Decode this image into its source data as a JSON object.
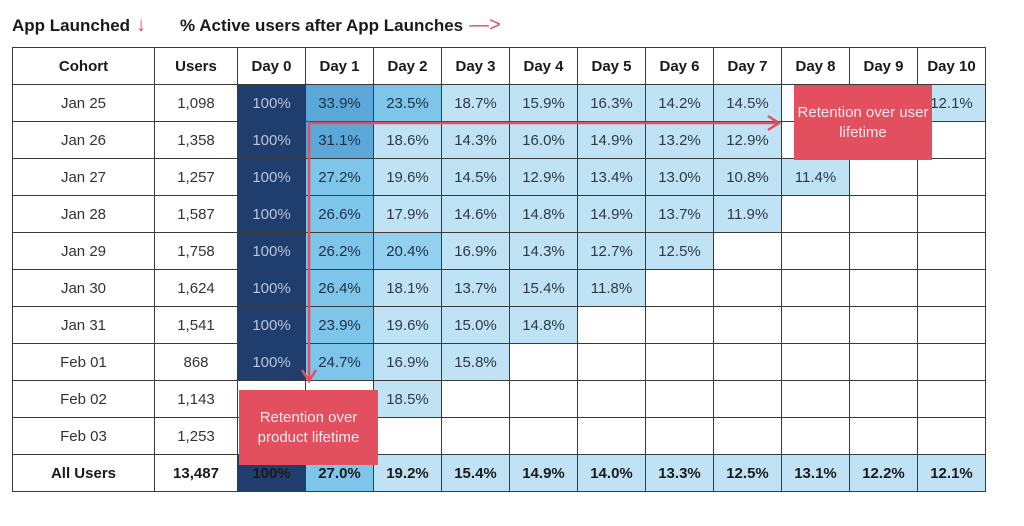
{
  "header": {
    "left_label": "App Launched",
    "left_arrow": "↓",
    "right_label": "% Active users after App Launches",
    "right_arrow": "—>"
  },
  "callouts": {
    "user_lifetime": "Retention over user lifetime",
    "product_lifetime": "Retention over product lifetime"
  },
  "colors": {
    "day0": "#1f3e6e",
    "high": "#5ba8d8",
    "mid_high": "#7ec5ea",
    "mid": "#93d0ef",
    "low": "#bfe3f4",
    "accent": "#e2505f"
  },
  "chart_data": {
    "type": "table",
    "title": "% Active users after App Launches",
    "columns": [
      "Cohort",
      "Users",
      "Day 0",
      "Day 1",
      "Day 2",
      "Day 3",
      "Day 4",
      "Day 5",
      "Day 6",
      "Day 7",
      "Day 8",
      "Day 9",
      "Day 10"
    ],
    "rows": [
      {
        "cohort": "Jan 25",
        "users": "1,098",
        "values": [
          "100%",
          "33.9%",
          "23.5%",
          "18.7%",
          "15.9%",
          "16.3%",
          "14.2%",
          "14.5%",
          "",
          "",
          "12.1%"
        ]
      },
      {
        "cohort": "Jan 26",
        "users": "1,358",
        "values": [
          "100%",
          "31.1%",
          "18.6%",
          "14.3%",
          "16.0%",
          "14.9%",
          "13.2%",
          "12.9%",
          "",
          "",
          ""
        ]
      },
      {
        "cohort": "Jan 27",
        "users": "1,257",
        "values": [
          "100%",
          "27.2%",
          "19.6%",
          "14.5%",
          "12.9%",
          "13.4%",
          "13.0%",
          "10.8%",
          "11.4%",
          "",
          ""
        ]
      },
      {
        "cohort": "Jan 28",
        "users": "1,587",
        "values": [
          "100%",
          "26.6%",
          "17.9%",
          "14.6%",
          "14.8%",
          "14.9%",
          "13.7%",
          "11.9%",
          "",
          "",
          ""
        ]
      },
      {
        "cohort": "Jan 29",
        "users": "1,758",
        "values": [
          "100%",
          "26.2%",
          "20.4%",
          "16.9%",
          "14.3%",
          "12.7%",
          "12.5%",
          "",
          "",
          "",
          ""
        ]
      },
      {
        "cohort": "Jan 30",
        "users": "1,624",
        "values": [
          "100%",
          "26.4%",
          "18.1%",
          "13.7%",
          "15.4%",
          "11.8%",
          "",
          "",
          "",
          "",
          ""
        ]
      },
      {
        "cohort": "Jan 31",
        "users": "1,541",
        "values": [
          "100%",
          "23.9%",
          "19.6%",
          "15.0%",
          "14.8%",
          "",
          "",
          "",
          "",
          "",
          ""
        ]
      },
      {
        "cohort": "Feb 01",
        "users": "868",
        "values": [
          "100%",
          "24.7%",
          "16.9%",
          "15.8%",
          "",
          "",
          "",
          "",
          "",
          "",
          ""
        ]
      },
      {
        "cohort": "Feb 02",
        "users": "1,143",
        "values": [
          "",
          "",
          "18.5%",
          "",
          "",
          "",
          "",
          "",
          "",
          "",
          ""
        ]
      },
      {
        "cohort": "Feb 03",
        "users": "1,253",
        "values": [
          "",
          "",
          "",
          "",
          "",
          "",
          "",
          "",
          "",
          "",
          ""
        ]
      }
    ],
    "total": {
      "cohort": "All Users",
      "users": "13,487",
      "values": [
        "100%",
        "27.0%",
        "19.2%",
        "15.4%",
        "14.9%",
        "14.0%",
        "13.3%",
        "12.5%",
        "13.1%",
        "12.2%",
        "12.1%"
      ]
    },
    "annotations": [
      "Retention over user lifetime",
      "Retention over product lifetime"
    ]
  }
}
